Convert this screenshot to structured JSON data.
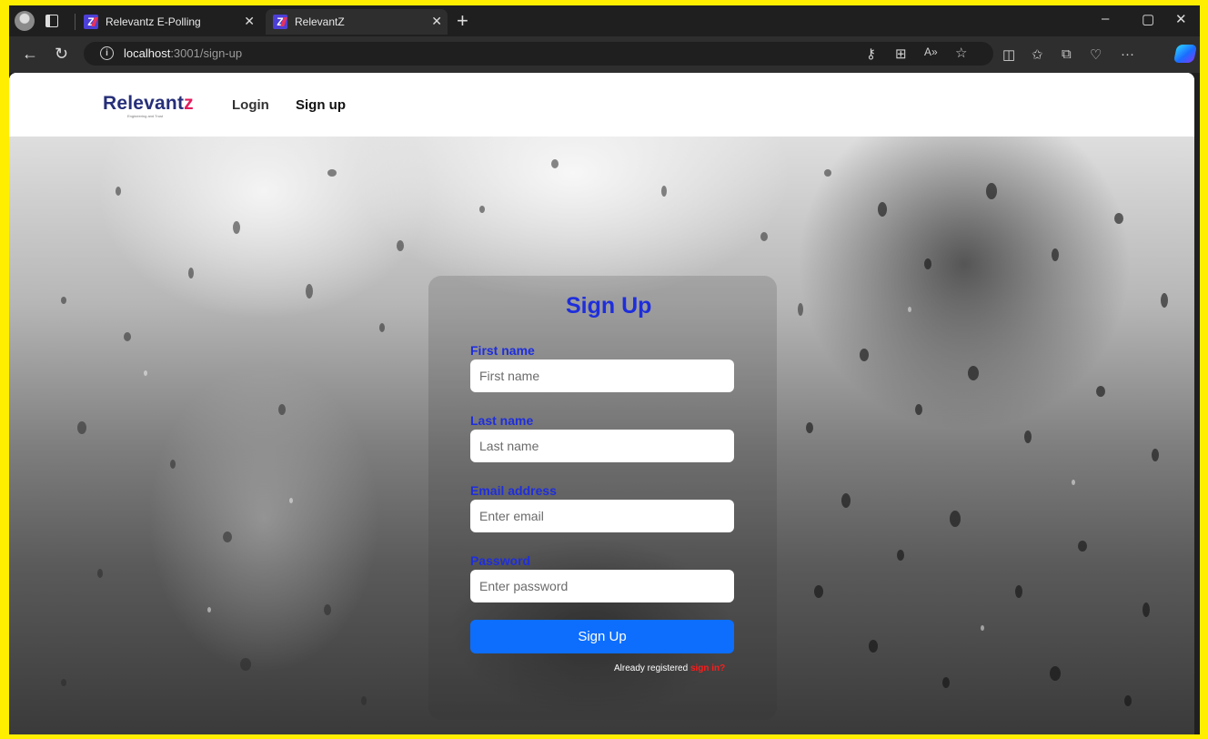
{
  "browser": {
    "tabs": [
      {
        "title": "Relevantz E-Polling",
        "favicon": "relevantz-z-icon"
      },
      {
        "title": "RelevantZ",
        "favicon": "relevantz-z-icon"
      }
    ],
    "url_host": "localhost",
    "url_path": ":3001/sign-up"
  },
  "nav": {
    "logo_text": "Relevant",
    "logo_mark": "z",
    "logo_tagline": "Engineering and Trust",
    "links": [
      "Login",
      "Sign up"
    ],
    "active_link": "Sign up"
  },
  "form": {
    "title": "Sign Up",
    "fields": [
      {
        "label": "First name",
        "placeholder": "First name"
      },
      {
        "label": "Last name",
        "placeholder": "Last name"
      },
      {
        "label": "Email address",
        "placeholder": "Enter email"
      },
      {
        "label": "Password",
        "placeholder": "Enter password"
      }
    ],
    "submit_label": "Sign Up",
    "already_text": "Already registered",
    "signin_label": "sign in?"
  },
  "colors": {
    "primary_button": "#0d6efd",
    "label_blue": "#1e2edb",
    "link_red": "#ff1a1a",
    "brand_navy": "#262f78",
    "brand_pink": "#e31d5c",
    "outer_border": "#ffee00"
  }
}
